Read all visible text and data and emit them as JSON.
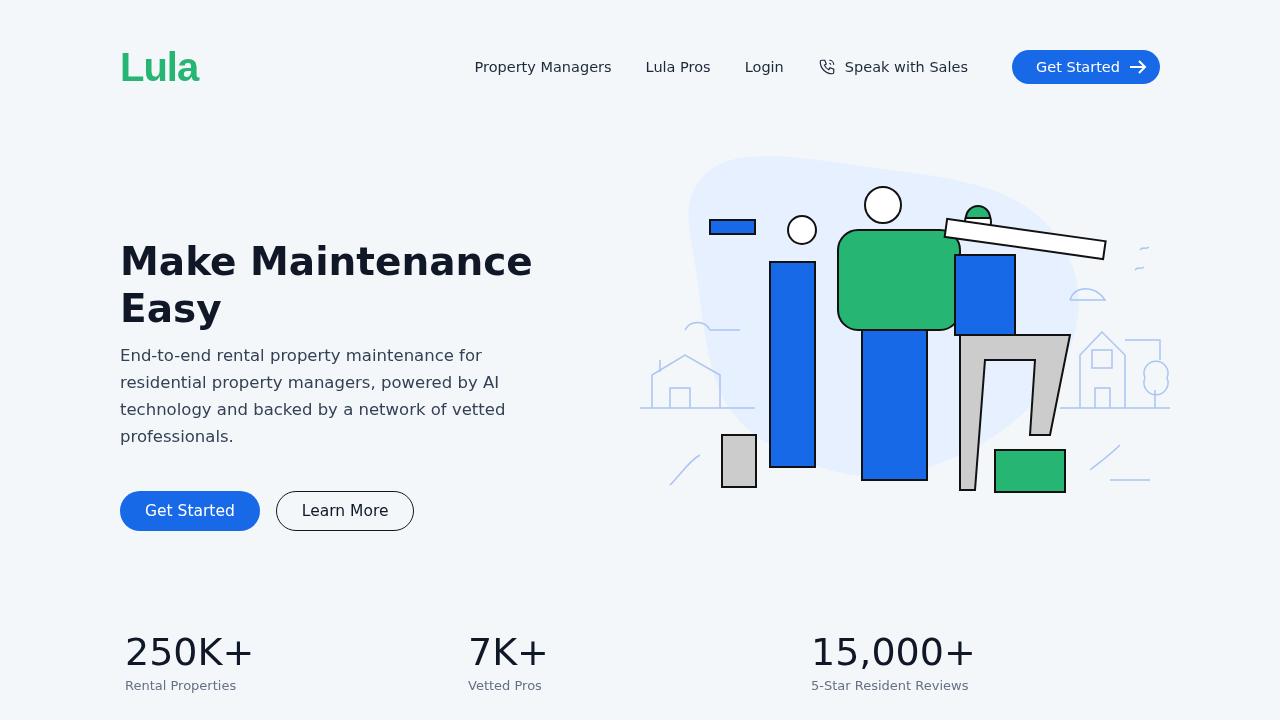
{
  "logo": "Lula",
  "nav": [
    {
      "label": "Property Managers"
    },
    {
      "label": "Lula Pros"
    },
    {
      "label": "Login"
    },
    {
      "label": "Speak with Sales",
      "kind": "phone"
    }
  ],
  "header_cta": "Get Started",
  "hero": {
    "title": "Make Maintenance Easy",
    "text": "End-to-end rental property maintenance for residential property managers, powered by AI technology and backed by a network of vetted professionals.",
    "buttons": [
      {
        "label": "Get Started",
        "kind": "primary"
      },
      {
        "label": "Learn More",
        "kind": "outline"
      }
    ]
  },
  "stats": [
    {
      "value": "250K+",
      "label": "Rental Properties"
    },
    {
      "value": "7K+",
      "label": "Vetted Pros"
    },
    {
      "value": "15,000+",
      "label": "5-Star Resident Reviews"
    }
  ]
}
